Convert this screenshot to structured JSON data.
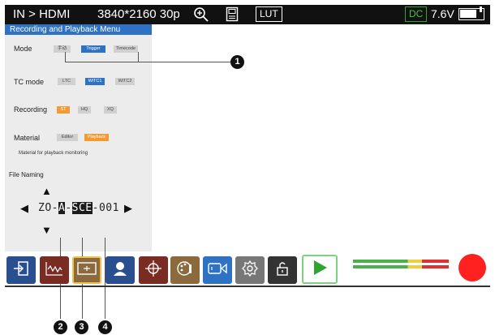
{
  "statusbar": {
    "input": "IN > HDMI",
    "format": "3840*2160 30p",
    "lut": "LUT",
    "power_source": "DC",
    "voltage": "7.6V",
    "battery_level": 0.75
  },
  "menu": {
    "title": "Recording and Playback Menu",
    "mode": {
      "label": "Mode",
      "options": [
        "手动",
        "Trigger",
        "Timecode"
      ],
      "selected": "Trigger"
    },
    "tc_mode": {
      "label": "TC mode",
      "options": [
        "LTC",
        "WiTC1",
        "WiTC2"
      ],
      "selected": "WiTC1"
    },
    "recording": {
      "label": "Recording",
      "options": [
        "ST",
        "HQ",
        "XQ"
      ],
      "selected": "ST"
    },
    "material": {
      "label": "Material",
      "options": [
        "Editor",
        "Playback"
      ],
      "selected": "Playback",
      "note": "Material for playback monitoring"
    },
    "file_naming": {
      "label": "File Naming",
      "parts": [
        "ZO-",
        "A",
        "-",
        "SCE",
        "-001"
      ]
    }
  },
  "callouts": [
    "1",
    "2",
    "3",
    "4"
  ],
  "toolbar": {
    "buttons": [
      {
        "name": "input-button",
        "icon": "enter-icon",
        "color": "#2a4f8f"
      },
      {
        "name": "waveform-button",
        "icon": "waveform-icon",
        "color": "#7a2c23"
      },
      {
        "name": "frame-button",
        "icon": "frame-icon",
        "color": "#8b6a3e"
      },
      {
        "name": "portrait-button",
        "icon": "person-icon",
        "color": "#2a4f8f"
      },
      {
        "name": "crosshair-button",
        "icon": "crosshair-icon",
        "color": "#7a2c23"
      },
      {
        "name": "palette-button",
        "icon": "palette-icon",
        "color": "#8b6a3e"
      },
      {
        "name": "record-mode-button",
        "icon": "camera-icon",
        "color": "#2f72c4"
      },
      {
        "name": "settings-button",
        "icon": "gear-icon",
        "color": "#777777"
      },
      {
        "name": "lock-button",
        "icon": "lock-icon",
        "color": "#333333"
      },
      {
        "name": "play-button",
        "icon": "play-icon",
        "color": "#2ea52e"
      }
    ]
  },
  "audio_meters": {
    "colors": [
      "#4ab04a",
      "#e9d040",
      "#e03030"
    ]
  },
  "record_button": {
    "color": "#ff2020"
  }
}
